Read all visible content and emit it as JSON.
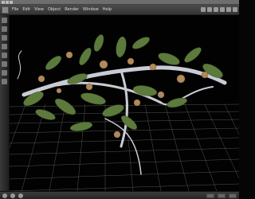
{
  "app": {
    "menu": [
      "File",
      "Edit",
      "View",
      "Object",
      "Render",
      "Window",
      "Help"
    ],
    "toolbar_icons": [
      "move-icon",
      "rotate-icon",
      "scale-icon",
      "camera-icon",
      "light-icon",
      "render-icon"
    ],
    "side_icons": [
      "select-icon",
      "move-icon",
      "rotate-icon",
      "scale-icon",
      "zoom-icon",
      "pan-icon",
      "orbit-icon",
      "grid-icon"
    ],
    "status_icons": [
      "play-icon",
      "stop-icon",
      "record-icon",
      "key-icon",
      "timeline-icon",
      "settings-icon"
    ]
  },
  "scene": {
    "background": "#020202",
    "grid_color": "#6a6a6a",
    "leaf_color": "#5c7a3c",
    "stem_color": "#c9ccd4",
    "bud_color": "#b08a5c"
  }
}
